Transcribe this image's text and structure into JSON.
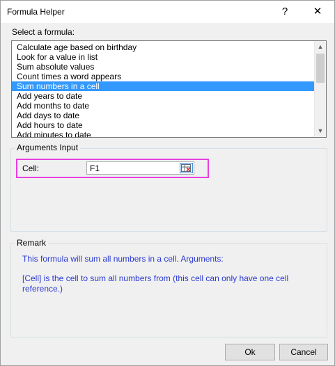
{
  "window": {
    "title": "Formula Helper",
    "help_glyph": "?",
    "close_glyph": "✕"
  },
  "formula_list": {
    "label": "Select a formula:",
    "items": [
      "Calculate age based on birthday",
      "Look for a value in list",
      "Sum absolute values",
      "Count times a word appears",
      "Sum numbers in a cell",
      "Add years to date",
      "Add months to date",
      "Add days to date",
      "Add hours to date",
      "Add minutes to date"
    ],
    "selected_index": 4
  },
  "arguments": {
    "legend": "Arguments Input",
    "cell_label": "Cell:",
    "cell_value": "F1",
    "highlight_color": "#e83fe2"
  },
  "remark": {
    "legend": "Remark",
    "line1": "This formula will sum all numbers in a cell. Arguments:",
    "line2": "[Cell] is the cell to sum all numbers from (this cell can only have one cell reference.)",
    "text_color": "#2a3ad1"
  },
  "buttons": {
    "ok": "Ok",
    "cancel": "Cancel"
  },
  "icons": {
    "scroll_up": "▲",
    "scroll_down": "▼",
    "picker": "range-picker-icon"
  }
}
